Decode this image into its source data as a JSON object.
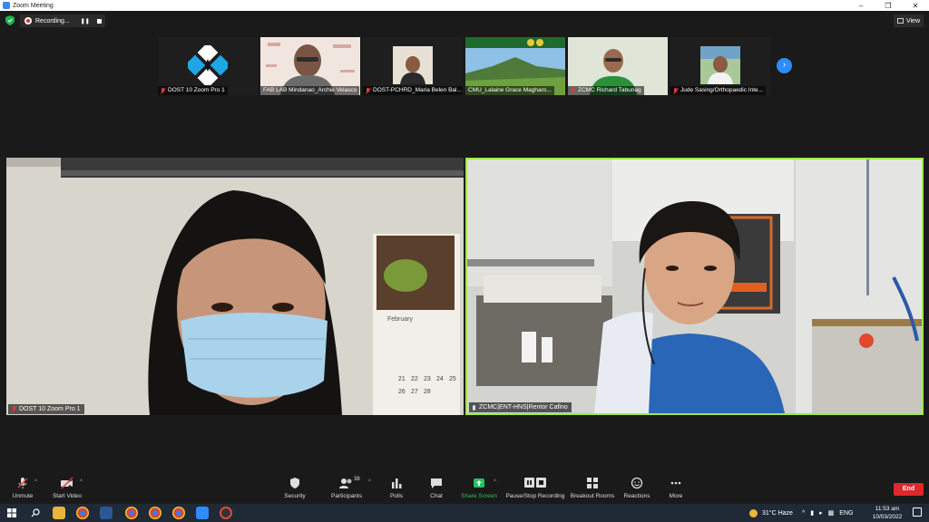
{
  "window": {
    "title": "Zoom Meeting"
  },
  "recording": {
    "label": "Recording..."
  },
  "view_button": {
    "label": "View"
  },
  "participants_strip": [
    {
      "name": "DOST 10 Zoom Pro 1",
      "muted": true,
      "content": "logo"
    },
    {
      "name": "FAB LAB Mindanao_Archie Velasco",
      "muted": false,
      "content": "person"
    },
    {
      "name": "DOST-PCHRD_Maria Belen Bal...",
      "muted": true,
      "content": "person"
    },
    {
      "name": "CMU_Lalaine Grace Magharo...",
      "muted": false,
      "content": "landscape"
    },
    {
      "name": "ZCMC Richard Tabunag",
      "muted": true,
      "content": "person"
    },
    {
      "name": "Jude Sasing/Orthopaedic Inte...",
      "muted": true,
      "content": "person"
    }
  ],
  "main_videos": [
    {
      "name": "DOST 10 Zoom Pro 1",
      "muted": true
    },
    {
      "name": "ZCMC|ENT-HNS|Rentor Cafino",
      "muted": false,
      "active_speaker": true
    }
  ],
  "calendar": {
    "month": "February",
    "days": [
      "21",
      "22",
      "23",
      "24",
      "25",
      "26",
      "27",
      "28"
    ]
  },
  "toolbar": {
    "unmute": "Unmute",
    "start_video": "Start Video",
    "security": "Security",
    "participants": "Participants",
    "participants_count": "38",
    "polls": "Polls",
    "chat": "Chat",
    "share_screen": "Share Screen",
    "recording": "Pause/Stop Recording",
    "breakout": "Breakout Rooms",
    "reactions": "Reactions",
    "more": "More",
    "end": "End"
  },
  "taskbar": {
    "weather": "31°C  Haze",
    "language": "ENG",
    "time": "11:53 am",
    "date": "10/03/2022"
  },
  "colors": {
    "accent": "#2d8cff",
    "active_speaker_border": "#9ee84a",
    "end": "#e02828",
    "share": "#22c55e"
  }
}
